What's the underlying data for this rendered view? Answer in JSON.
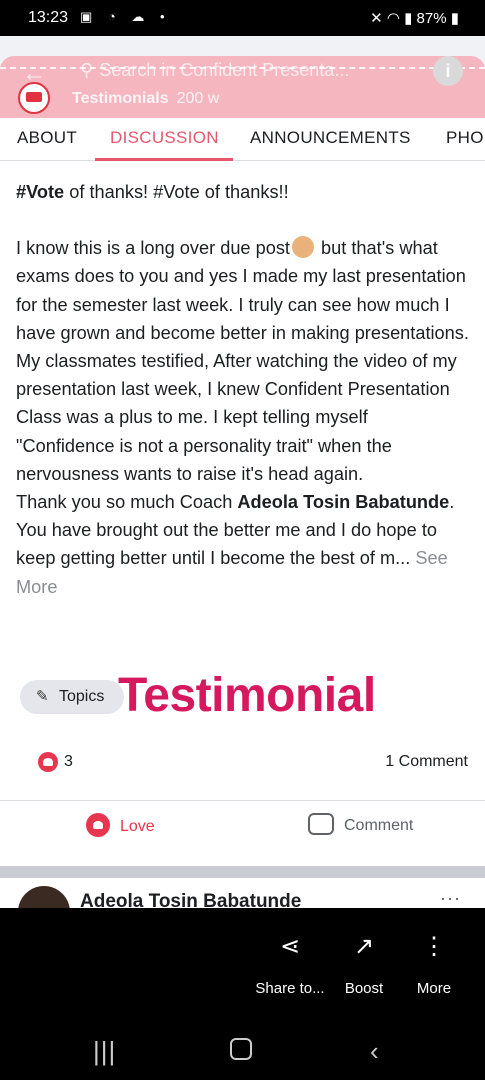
{
  "status": {
    "time": "13:23",
    "battery": "87%"
  },
  "header": {
    "search_placeholder": "Search in Confident Presenta...",
    "group_tab": "Testimonials",
    "age": "200 w"
  },
  "tabs": [
    {
      "label": "ABOUT"
    },
    {
      "label": "DISCUSSION"
    },
    {
      "label": "ANNOUNCEMENTS"
    },
    {
      "label": "PHO"
    }
  ],
  "post": {
    "vote_a": "#Vote",
    "vote_b": " of thanks! #Vote of thanks!!",
    "p2a": "I know this is a long over due post",
    "p2b": " but that's what exams does to you and yes I made my last presentation for the semester last week. I truly can see how much I have grown and become better in making presentations. My classmates testified, After watching the video of my presentation last week, I knew Confident Presentation Class was a plus to me. I kept telling myself \"Confidence is not a personality trait\" when the nervousness wants to raise it's head again.",
    "p3a": "Thank you so much Coach ",
    "p3_name": "Adeola Tosin Babatunde",
    "p3b": ". You have brought out the better me and I do hope to keep getting better until I become the best of m...",
    "see_more": " See More"
  },
  "topics": {
    "chip_label": "Topics",
    "topic": "Testimonial"
  },
  "stats": {
    "likes": "3",
    "comments": "1 Comment"
  },
  "actions": {
    "love": "Love",
    "comment": "Comment"
  },
  "next_post": {
    "author": "Adeola Tosin Babatunde",
    "more": "···"
  },
  "bottom_menu": [
    {
      "label": "Share to..."
    },
    {
      "label": "Boost"
    },
    {
      "label": "More"
    }
  ]
}
